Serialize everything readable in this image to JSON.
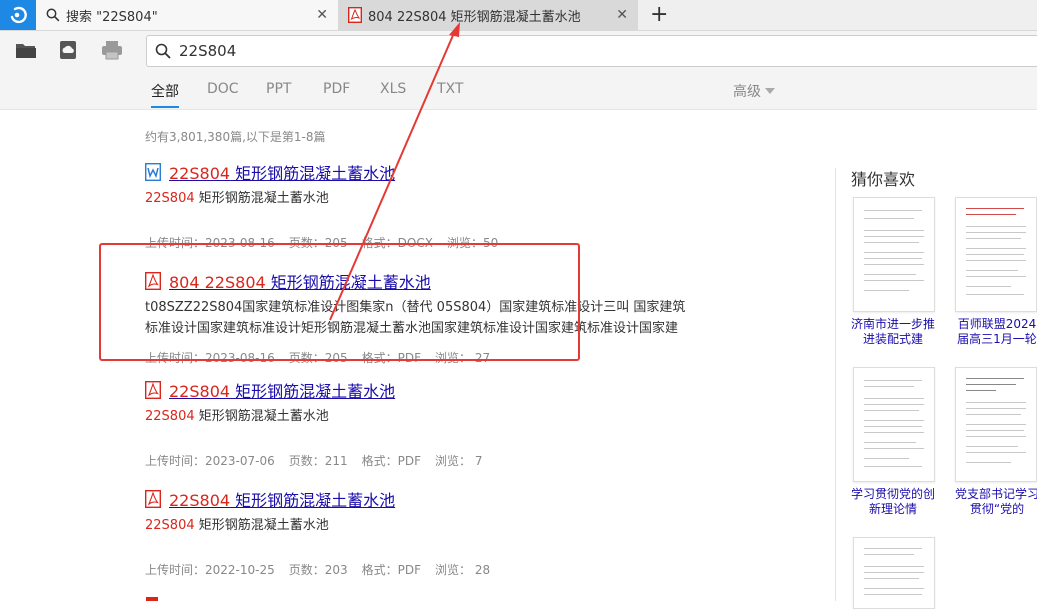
{
  "tabs": [
    {
      "label": "搜索 \"22S804\"",
      "icon": "search-icon"
    },
    {
      "label": "804 22S804 矩形钢筋混凝土蓄水池",
      "icon": "pdf-icon"
    }
  ],
  "search": {
    "value": "22S804"
  },
  "filters": [
    "全部",
    "DOC",
    "PPT",
    "PDF",
    "XLS",
    "TXT"
  ],
  "advanced_label": "高级",
  "result_count": "约有3,801,380篇,以下是第1-8篇",
  "results": [
    {
      "type": "docx",
      "title_hl": "22S804",
      "title_rest": " 矩形钢筋混凝土蓄水池",
      "snippet_hl": "22S804",
      "snippet_rest": " 矩形钢筋混凝土蓄水池",
      "meta": {
        "uploaded": "上传时间：2023-08-16",
        "pages": "页数：205",
        "format": "格式：DOCX",
        "views": "浏览：50"
      }
    },
    {
      "type": "pdf",
      "title_prefix": "804 ",
      "title_hl": "22S804",
      "title_rest": " 矩形钢筋混凝土蓄水池",
      "snippet_line1": "t08SZZ22S804国家建筑标准设计图集家n（替代 05S804）国家建筑标准设计三叫 国家建筑",
      "snippet_line2": "标准设计国家建筑标准设计矩形钢筋混凝土蓄水池国家建筑标准设计国家建筑标准设计国家建",
      "meta": {
        "uploaded": "上传时间：2023-08-16",
        "pages": "页数：205",
        "format": "格式：PDF",
        "views": "浏览：  27"
      }
    },
    {
      "type": "pdf",
      "title_hl": "22S804",
      "title_rest": " 矩形钢筋混凝土蓄水池",
      "snippet_hl": "22S804",
      "snippet_rest": " 矩形钢筋混凝土蓄水池",
      "meta": {
        "uploaded": "上传时间：2023-07-06",
        "pages": "页数：211",
        "format": "格式：PDF",
        "views": "浏览：  7"
      }
    },
    {
      "type": "pdf",
      "title_hl": "22S804",
      "title_rest": " 矩形钢筋混凝土蓄水池",
      "snippet_hl": "22S804",
      "snippet_rest": " 矩形钢筋混凝土蓄水池",
      "meta": {
        "uploaded": "上传时间：2022-10-25",
        "pages": "页数：203",
        "format": "格式：PDF",
        "views": "浏览：  28"
      }
    }
  ],
  "sidebar": {
    "title": "猜你喜欢",
    "cards": [
      {
        "label": "济南市进一步推进装配式建"
      },
      {
        "label": "百师联盟2024届高三1月一轮"
      },
      {
        "label": "学习贯彻党的创新理论情"
      },
      {
        "label": "党支部书记学习贯彻“党的"
      }
    ]
  },
  "colors": {
    "accent": "#1e88e5",
    "highlight": "#d9261c",
    "link": "#1a0dab",
    "annotation": "#e53935"
  }
}
